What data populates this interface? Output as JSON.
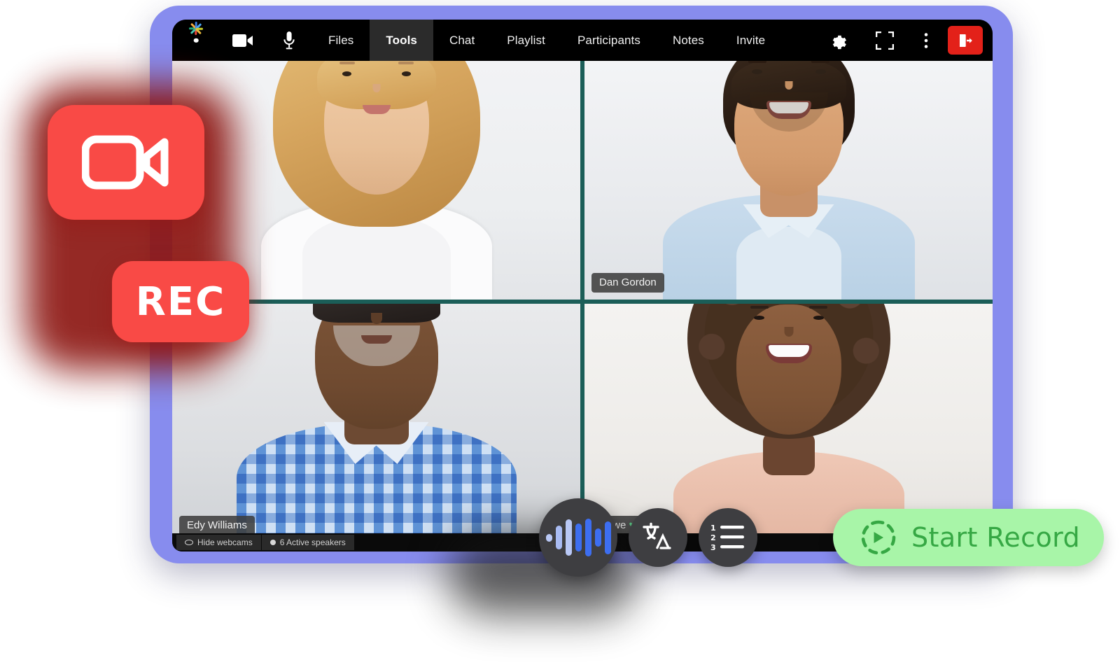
{
  "app": {
    "logo_icon": "starburst-logo-icon",
    "logo_colors": [
      "#e8453c",
      "#1ea97c",
      "#f2a93b",
      "#3b7ddd",
      "#45c4b0",
      "#c9d12a",
      "#4aa3f0",
      "#e8453c"
    ],
    "frame_color": "#878cee",
    "screen_bg": "#000000"
  },
  "toolbar": {
    "camera_icon": "video-camera-icon",
    "mic_icon": "microphone-icon",
    "tabs": [
      {
        "label": "Files",
        "active": false
      },
      {
        "label": "Tools",
        "active": true
      },
      {
        "label": "Chat",
        "active": false
      },
      {
        "label": "Playlist",
        "active": false
      },
      {
        "label": "Participants",
        "active": false
      },
      {
        "label": "Notes",
        "active": false
      },
      {
        "label": "Invite",
        "active": false
      }
    ],
    "settings_icon": "gear-icon",
    "fullscreen_icon": "fullscreen-icon",
    "more_icon": "kebab-menu-icon",
    "exit_icon": "exit-door-icon",
    "exit_color": "#e32119"
  },
  "grid": {
    "divider_color": "#1b5e58",
    "participants": [
      {
        "name": "",
        "position": "top-left"
      },
      {
        "name": "Dan Gordon",
        "position": "top-right"
      },
      {
        "name": "Edy Williams",
        "position": "bottom-left"
      },
      {
        "name": "Rowe",
        "position": "bottom-right"
      }
    ]
  },
  "statusbar": {
    "chips": [
      {
        "label": "Hide webcams",
        "icon": "eye-slash-icon"
      },
      {
        "label": "6 Active speakers",
        "icon": "speaker-dot-icon"
      }
    ]
  },
  "float_toolbar": {
    "buttons": [
      {
        "name": "audio-waveform",
        "icon": "audio-waveform-icon"
      },
      {
        "name": "translate",
        "icon": "translate-icon"
      },
      {
        "name": "numbered-list",
        "icon": "numbered-list-icon"
      }
    ],
    "bg_color": "#3e3e41"
  },
  "start_record": {
    "label": "Start Record",
    "icon": "play-in-dashed-circle-icon",
    "bg_color": "#a8f5a8",
    "text_color": "#36a844"
  },
  "rec_badges": {
    "camera_icon": "video-camera-icon",
    "rec_label": "REC",
    "bg_color": "#f94a46",
    "shadow_color": "#8d1713"
  }
}
